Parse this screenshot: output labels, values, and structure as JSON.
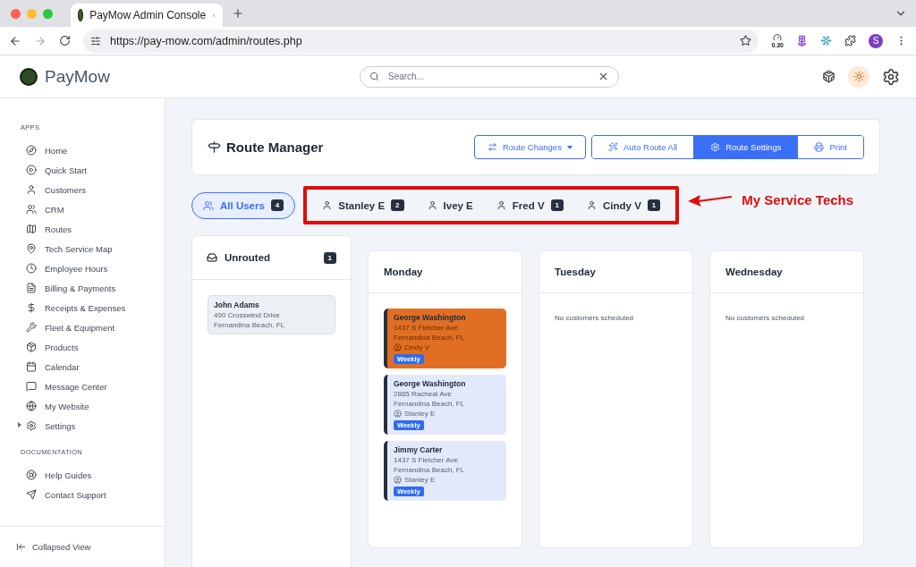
{
  "browser": {
    "tab_title": "PayMow Admin Console",
    "url": "https://pay-mow.com/admin/routes.php",
    "extension_badge": "0.30",
    "profile_initial": "S"
  },
  "header": {
    "logo": "PayMow",
    "search": {
      "placeholder": "Search..."
    }
  },
  "sidebar": {
    "sections": [
      {
        "heading": "APPS",
        "items": [
          {
            "label": "Home",
            "kind": "link"
          },
          {
            "label": "Quick Start",
            "kind": "link"
          },
          {
            "label": "Customers",
            "kind": "link"
          },
          {
            "label": "CRM",
            "kind": "link"
          },
          {
            "label": "Routes",
            "kind": "link"
          },
          {
            "label": "Tech Service Map",
            "kind": "link"
          },
          {
            "label": "Employee Hours",
            "kind": "link"
          },
          {
            "label": "Billing & Payments",
            "kind": "link"
          },
          {
            "label": "Receipts & Expenses",
            "kind": "link"
          },
          {
            "label": "Fleet & Equipment",
            "kind": "link"
          },
          {
            "label": "Products",
            "kind": "link"
          },
          {
            "label": "Calendar",
            "kind": "link"
          },
          {
            "label": "Message Center",
            "kind": "link"
          },
          {
            "label": "My Website",
            "kind": "link"
          },
          {
            "label": "Settings",
            "kind": "group",
            "expanded": false
          }
        ]
      },
      {
        "heading": "DOCUMENTATION",
        "items": [
          {
            "label": "Help Guides",
            "kind": "link"
          },
          {
            "label": "Contact Support",
            "kind": "link"
          }
        ]
      }
    ],
    "footer": "Collapsed View"
  },
  "page": {
    "title": "Route Manager",
    "actions": [
      {
        "label": "Route Changes",
        "kind": "dropdown"
      },
      {
        "label": "Auto Route All",
        "kind": "group",
        "selected": false
      },
      {
        "label": "Route Settings",
        "kind": "group",
        "selected": true
      },
      {
        "label": "Print",
        "kind": "group",
        "selected": false
      }
    ]
  },
  "user_filters": [
    {
      "label": "All Users",
      "count": "4",
      "selected": true
    },
    {
      "label": "Stanley E",
      "count": "2",
      "selected": false
    },
    {
      "label": "Ivey E",
      "selected": false
    },
    {
      "label": "Fred V",
      "count": "1",
      "selected": false
    },
    {
      "label": "Cindy V",
      "count": "1",
      "selected": false
    }
  ],
  "annotation": {
    "label": "My Service Techs"
  },
  "unrouted": {
    "title": "Unrouted",
    "count": "1",
    "customers": [
      {
        "name": "John Adams",
        "address": "490 Crosswind Drive",
        "city": "Fernandina Beach, FL"
      }
    ]
  },
  "days": [
    {
      "name": "Monday",
      "stops": [
        {
          "name": "George Washington",
          "address": "1437 S Fletcher Ave",
          "city": "Fernandina Beach, FL",
          "tech": "Cindy V",
          "frequency": "Weekly",
          "color": "#e06f24"
        },
        {
          "name": "George Washington",
          "address": "2865 Racheal Ave",
          "city": "Fernandina Beach, FL",
          "tech": "Stanley E",
          "frequency": "Weekly",
          "color": "#e2e9fb"
        },
        {
          "name": "Jimmy Carter",
          "address": "1437 S Fletcher Ave",
          "city": "Fernandina Beach, FL",
          "tech": "Stanley E",
          "frequency": "Weekly",
          "color": "#e2e9fb"
        }
      ]
    },
    {
      "name": "Tuesday",
      "empty_text": "No customers scheduled"
    },
    {
      "name": "Wednesday",
      "empty_text": "No customers scheduled"
    }
  ]
}
